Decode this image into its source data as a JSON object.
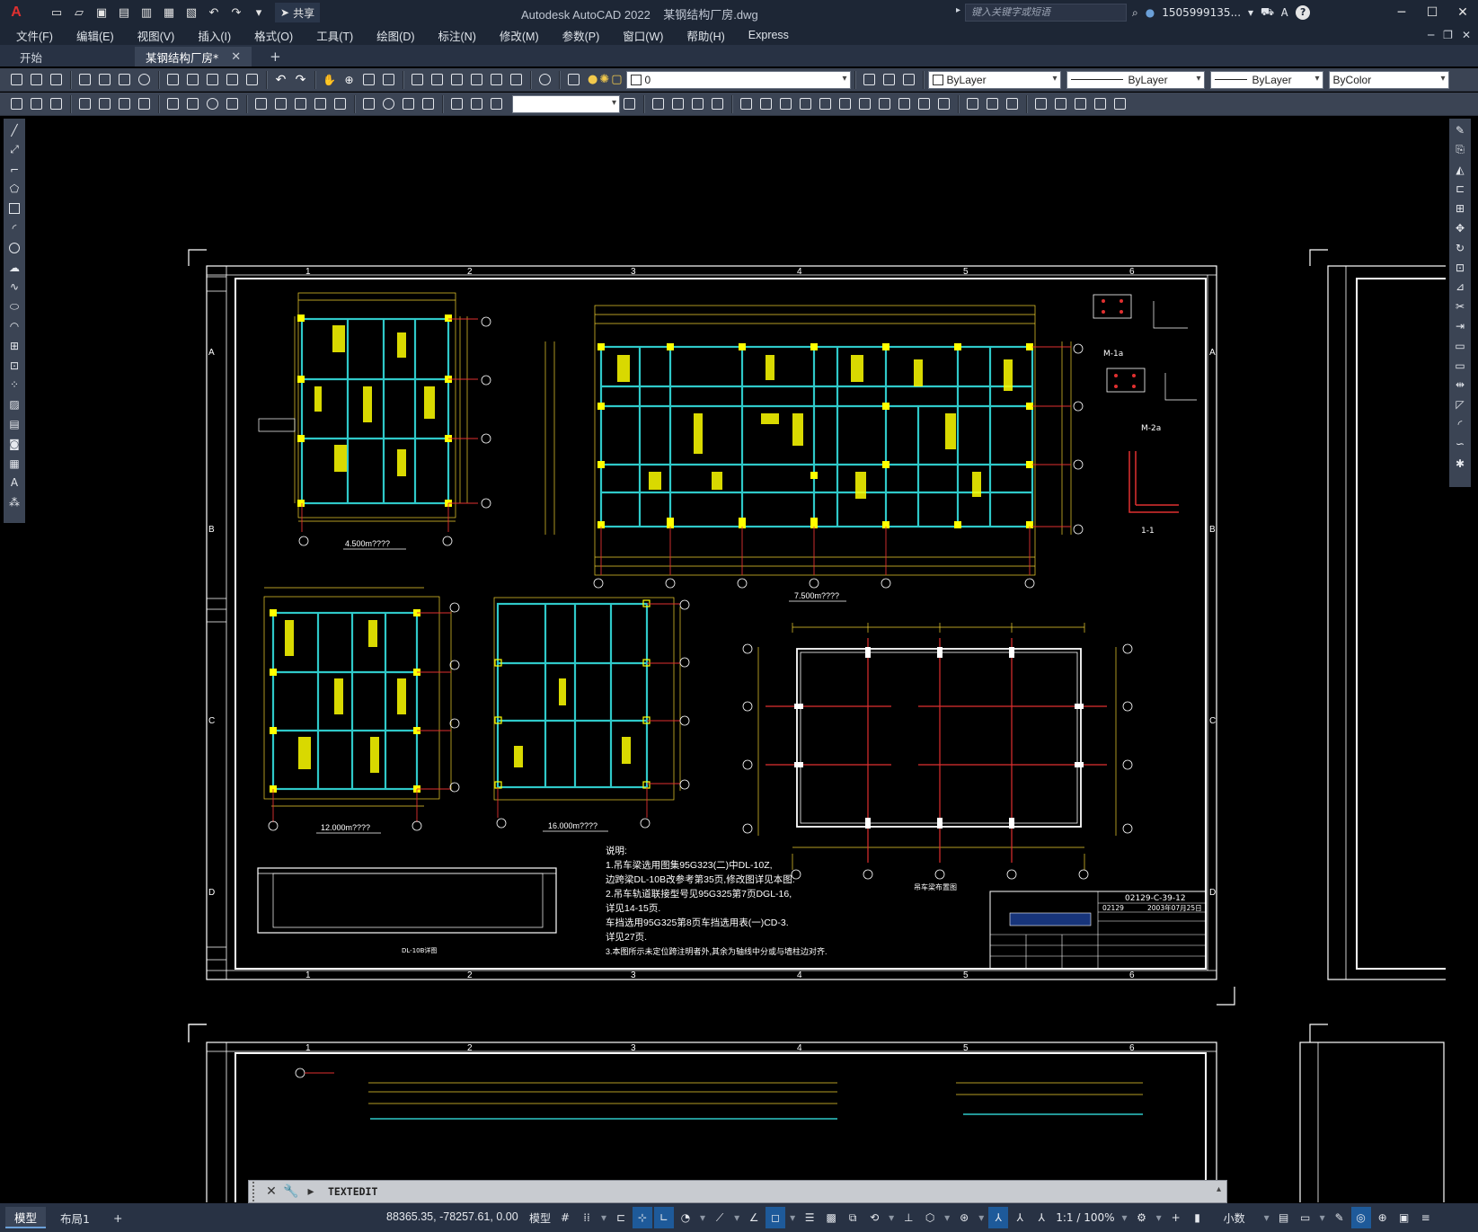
{
  "app": {
    "logo": "A",
    "title": "Autodesk AutoCAD 2022",
    "filename": "某钢结构厂房.dwg",
    "share_label": "共享",
    "search_placeholder": "键入关键字或短语",
    "user": "1505999135...",
    "help": "?"
  },
  "menu": [
    "文件(F)",
    "编辑(E)",
    "视图(V)",
    "插入(I)",
    "格式(O)",
    "工具(T)",
    "绘图(D)",
    "标注(N)",
    "修改(M)",
    "参数(P)",
    "窗口(W)",
    "帮助(H)",
    "Express"
  ],
  "tabs": {
    "start": "开始",
    "active": "某钢结构厂房*",
    "close": "✕",
    "add": "+"
  },
  "properties": {
    "layer": "0",
    "color": "ByLayer",
    "linetype": "ByLayer",
    "lineweight": "ByLayer",
    "plotstyle": "ByColor"
  },
  "drawing": {
    "grid_numbers": [
      "1",
      "2",
      "3",
      "4",
      "5",
      "6"
    ],
    "row_letters": [
      "A",
      "B",
      "C",
      "D"
    ],
    "plan_labels": [
      "4.500m????",
      "7.500m????",
      "12.000m????",
      "16.000m????"
    ],
    "crane_plan_title": "吊车梁布置图",
    "beam_detail_title": "DL-10B详图",
    "section_label": "1-1",
    "plate_labels": [
      "M-1a",
      "M-2a"
    ],
    "notes": {
      "heading": "说明:",
      "lines": [
        "1.吊车梁选用图集95G323(二)中DL-10Z,",
        "边跨梁DL-10B改参考第35页,修改图详见本图.",
        "2.吊车轨道联接型号见95G325第7页DGL-16,",
        "详见14-15页.",
        "车挡选用95G325第8页车挡选用表(一)CD-3.",
        "详见27页.",
        "3.本图所示未定位跨注明者外,其余为轴线中分或与墙柱边对齐."
      ]
    },
    "title_block": {
      "drawing_no": "02129-C-39-12",
      "date": "2003年07月25日",
      "project_no": "02129"
    }
  },
  "command": {
    "prompt": "TEXTEDIT"
  },
  "status": {
    "layout_tabs": [
      "模型",
      "布局1"
    ],
    "add_layout": "+",
    "coords": "88365.35, -78257.61, 0.00",
    "model_label": "模型",
    "scale": "1:1 / 100%",
    "units": "小数"
  }
}
